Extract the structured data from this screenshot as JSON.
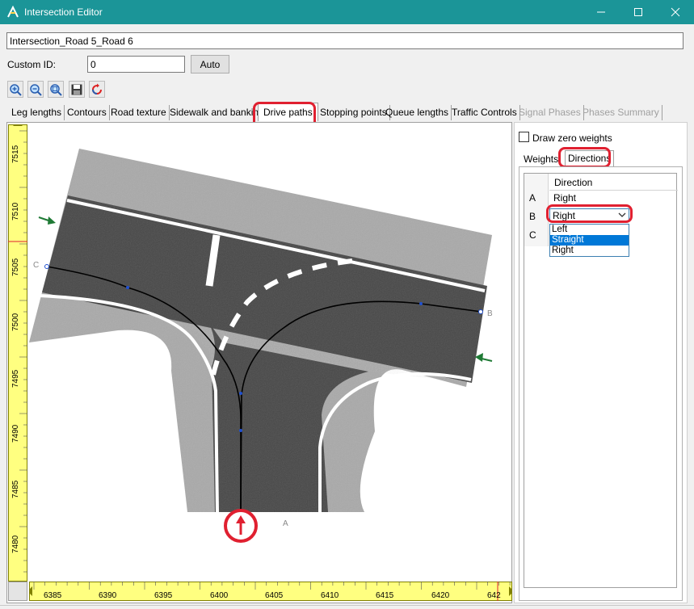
{
  "window": {
    "title": "Intersection Editor"
  },
  "form": {
    "name_value": "Intersection_Road 5_Road 6",
    "custom_id_label": "Custom ID:",
    "custom_id_value": "0",
    "auto_label": "Auto"
  },
  "tabs": [
    {
      "label": "Leg lengths",
      "state": "normal"
    },
    {
      "label": "Contours",
      "state": "normal"
    },
    {
      "label": "Road texture",
      "state": "normal"
    },
    {
      "label": "Sidewalk and banking",
      "state": "normal"
    },
    {
      "label": "Drive paths",
      "state": "active"
    },
    {
      "label": "Stopping points",
      "state": "normal"
    },
    {
      "label": "Queue lengths",
      "state": "normal"
    },
    {
      "label": "Traffic Controls",
      "state": "normal"
    },
    {
      "label": "Signal Phases",
      "state": "disabled"
    },
    {
      "label": "Phases Summary",
      "state": "disabled"
    }
  ],
  "toolbar": {
    "icons": [
      "zoom-in-icon",
      "zoom-out-icon",
      "zoom-fit-icon",
      "save-icon",
      "refresh-icon"
    ]
  },
  "ruler": {
    "y_labels": [
      "7515",
      "7510",
      "7505",
      "7500",
      "7495",
      "7490",
      "7485",
      "7480"
    ],
    "x_labels": [
      "6385",
      "6390",
      "6395",
      "6400",
      "6405",
      "6410",
      "6415",
      "6420",
      "642"
    ]
  },
  "map": {
    "leg_labels": [
      "A",
      "B",
      "C"
    ]
  },
  "right": {
    "draw_zero_label": "Draw zero weights",
    "draw_zero_checked": false,
    "subtabs": [
      {
        "label": "Weights",
        "active": false
      },
      {
        "label": "Directions",
        "active": true
      }
    ],
    "grid": {
      "header": "Direction",
      "rows": [
        {
          "leg": "A",
          "direction": "Right"
        },
        {
          "leg": "B",
          "direction": "Right"
        },
        {
          "leg": "C",
          "direction": ""
        }
      ]
    },
    "dropdown": {
      "options": [
        "Left",
        "Straight",
        "Right"
      ],
      "highlighted": "Straight"
    }
  },
  "colors": {
    "titlebar": "#1b9598",
    "highlight": "#e02030",
    "ruler": "#ffff80",
    "selection": "#0078d7",
    "arrow": "#1f7a35"
  }
}
